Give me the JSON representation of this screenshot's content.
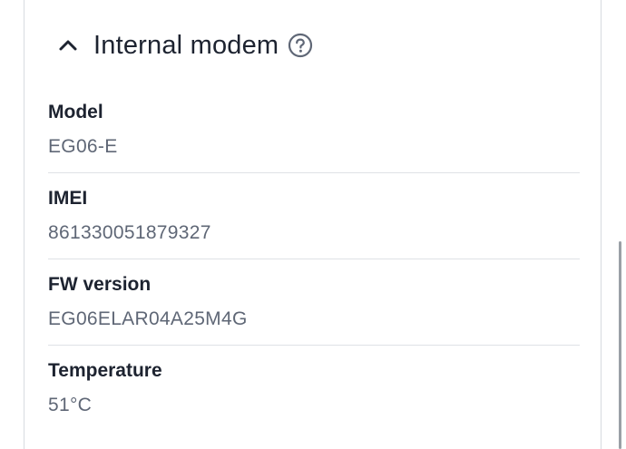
{
  "section": {
    "title": "Internal modem",
    "chevron_icon": "chevron-up-icon",
    "help_icon": "help-circle-icon",
    "expanded": true
  },
  "fields": [
    {
      "label": "Model",
      "value": "EG06-E"
    },
    {
      "label": "IMEI",
      "value": "861330051879327"
    },
    {
      "label": "FW version",
      "value": "EG06ELAR04A25M4G"
    },
    {
      "label": "Temperature",
      "value": "51°C"
    }
  ],
  "colors": {
    "title_text": "#1d2330",
    "value_text": "#5f6776",
    "divider": "#dfe2e6",
    "icon": "#5f6776"
  }
}
